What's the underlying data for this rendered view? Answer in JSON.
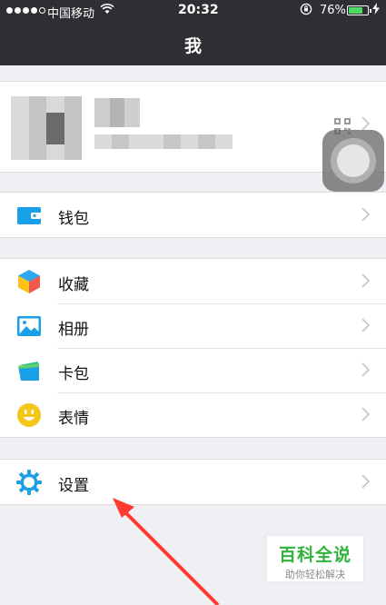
{
  "status_bar": {
    "carrier": "中国移动",
    "time": "20:32",
    "battery_percent": "76%",
    "battery_level": 0.76,
    "signal_bars_filled": 4,
    "signal_bars_total": 5
  },
  "nav": {
    "title": "我"
  },
  "menu": {
    "group1": [
      {
        "label": "钱包",
        "icon": "wallet-icon"
      }
    ],
    "group2": [
      {
        "label": "收藏",
        "icon": "favorites-cube-icon"
      },
      {
        "label": "相册",
        "icon": "album-icon"
      },
      {
        "label": "卡包",
        "icon": "card-pack-icon"
      },
      {
        "label": "表情",
        "icon": "smiley-icon"
      }
    ],
    "group3": [
      {
        "label": "设置",
        "icon": "gear-icon"
      }
    ]
  },
  "watermark": {
    "title": "百科全说",
    "subtitle": "助你轻松解决"
  },
  "colors": {
    "nav_background": "#2f2f33",
    "page_background": "#efeff4",
    "icon_blue": "#1aa0e8",
    "smiley_yellow": "#f5c518",
    "annotation_red": "#ff3b30",
    "watermark_green": "#2fb33b",
    "battery_green": "#4cd964"
  }
}
